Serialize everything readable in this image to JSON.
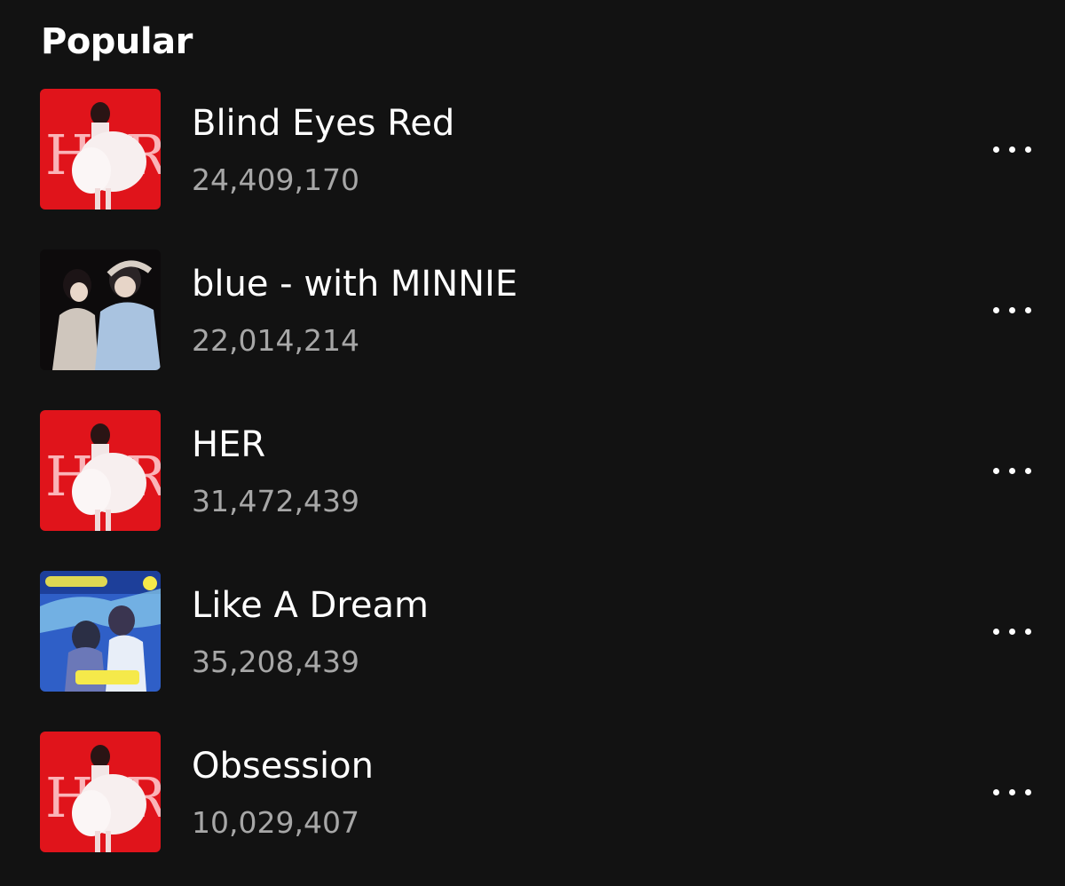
{
  "section": {
    "title": "Popular"
  },
  "tracks": [
    {
      "title": "Blind Eyes Red",
      "plays": "24,409,170",
      "cover": "red-album-cover"
    },
    {
      "title": "blue - with MINNIE",
      "plays": "22,014,214",
      "cover": "dark-photo-cover"
    },
    {
      "title": "HER",
      "plays": "31,472,439",
      "cover": "red-album-cover"
    },
    {
      "title": "Like A Dream",
      "plays": "35,208,439",
      "cover": "blue-drama-ost-cover"
    },
    {
      "title": "Obsession",
      "plays": "10,029,407",
      "cover": "red-album-cover"
    }
  ],
  "colors": {
    "background": "#121212",
    "title_text": "#ffffff",
    "secondary_text": "#a7a7a7",
    "album_red": "#e0141b"
  },
  "icons": {
    "more": "more-options-icon"
  }
}
